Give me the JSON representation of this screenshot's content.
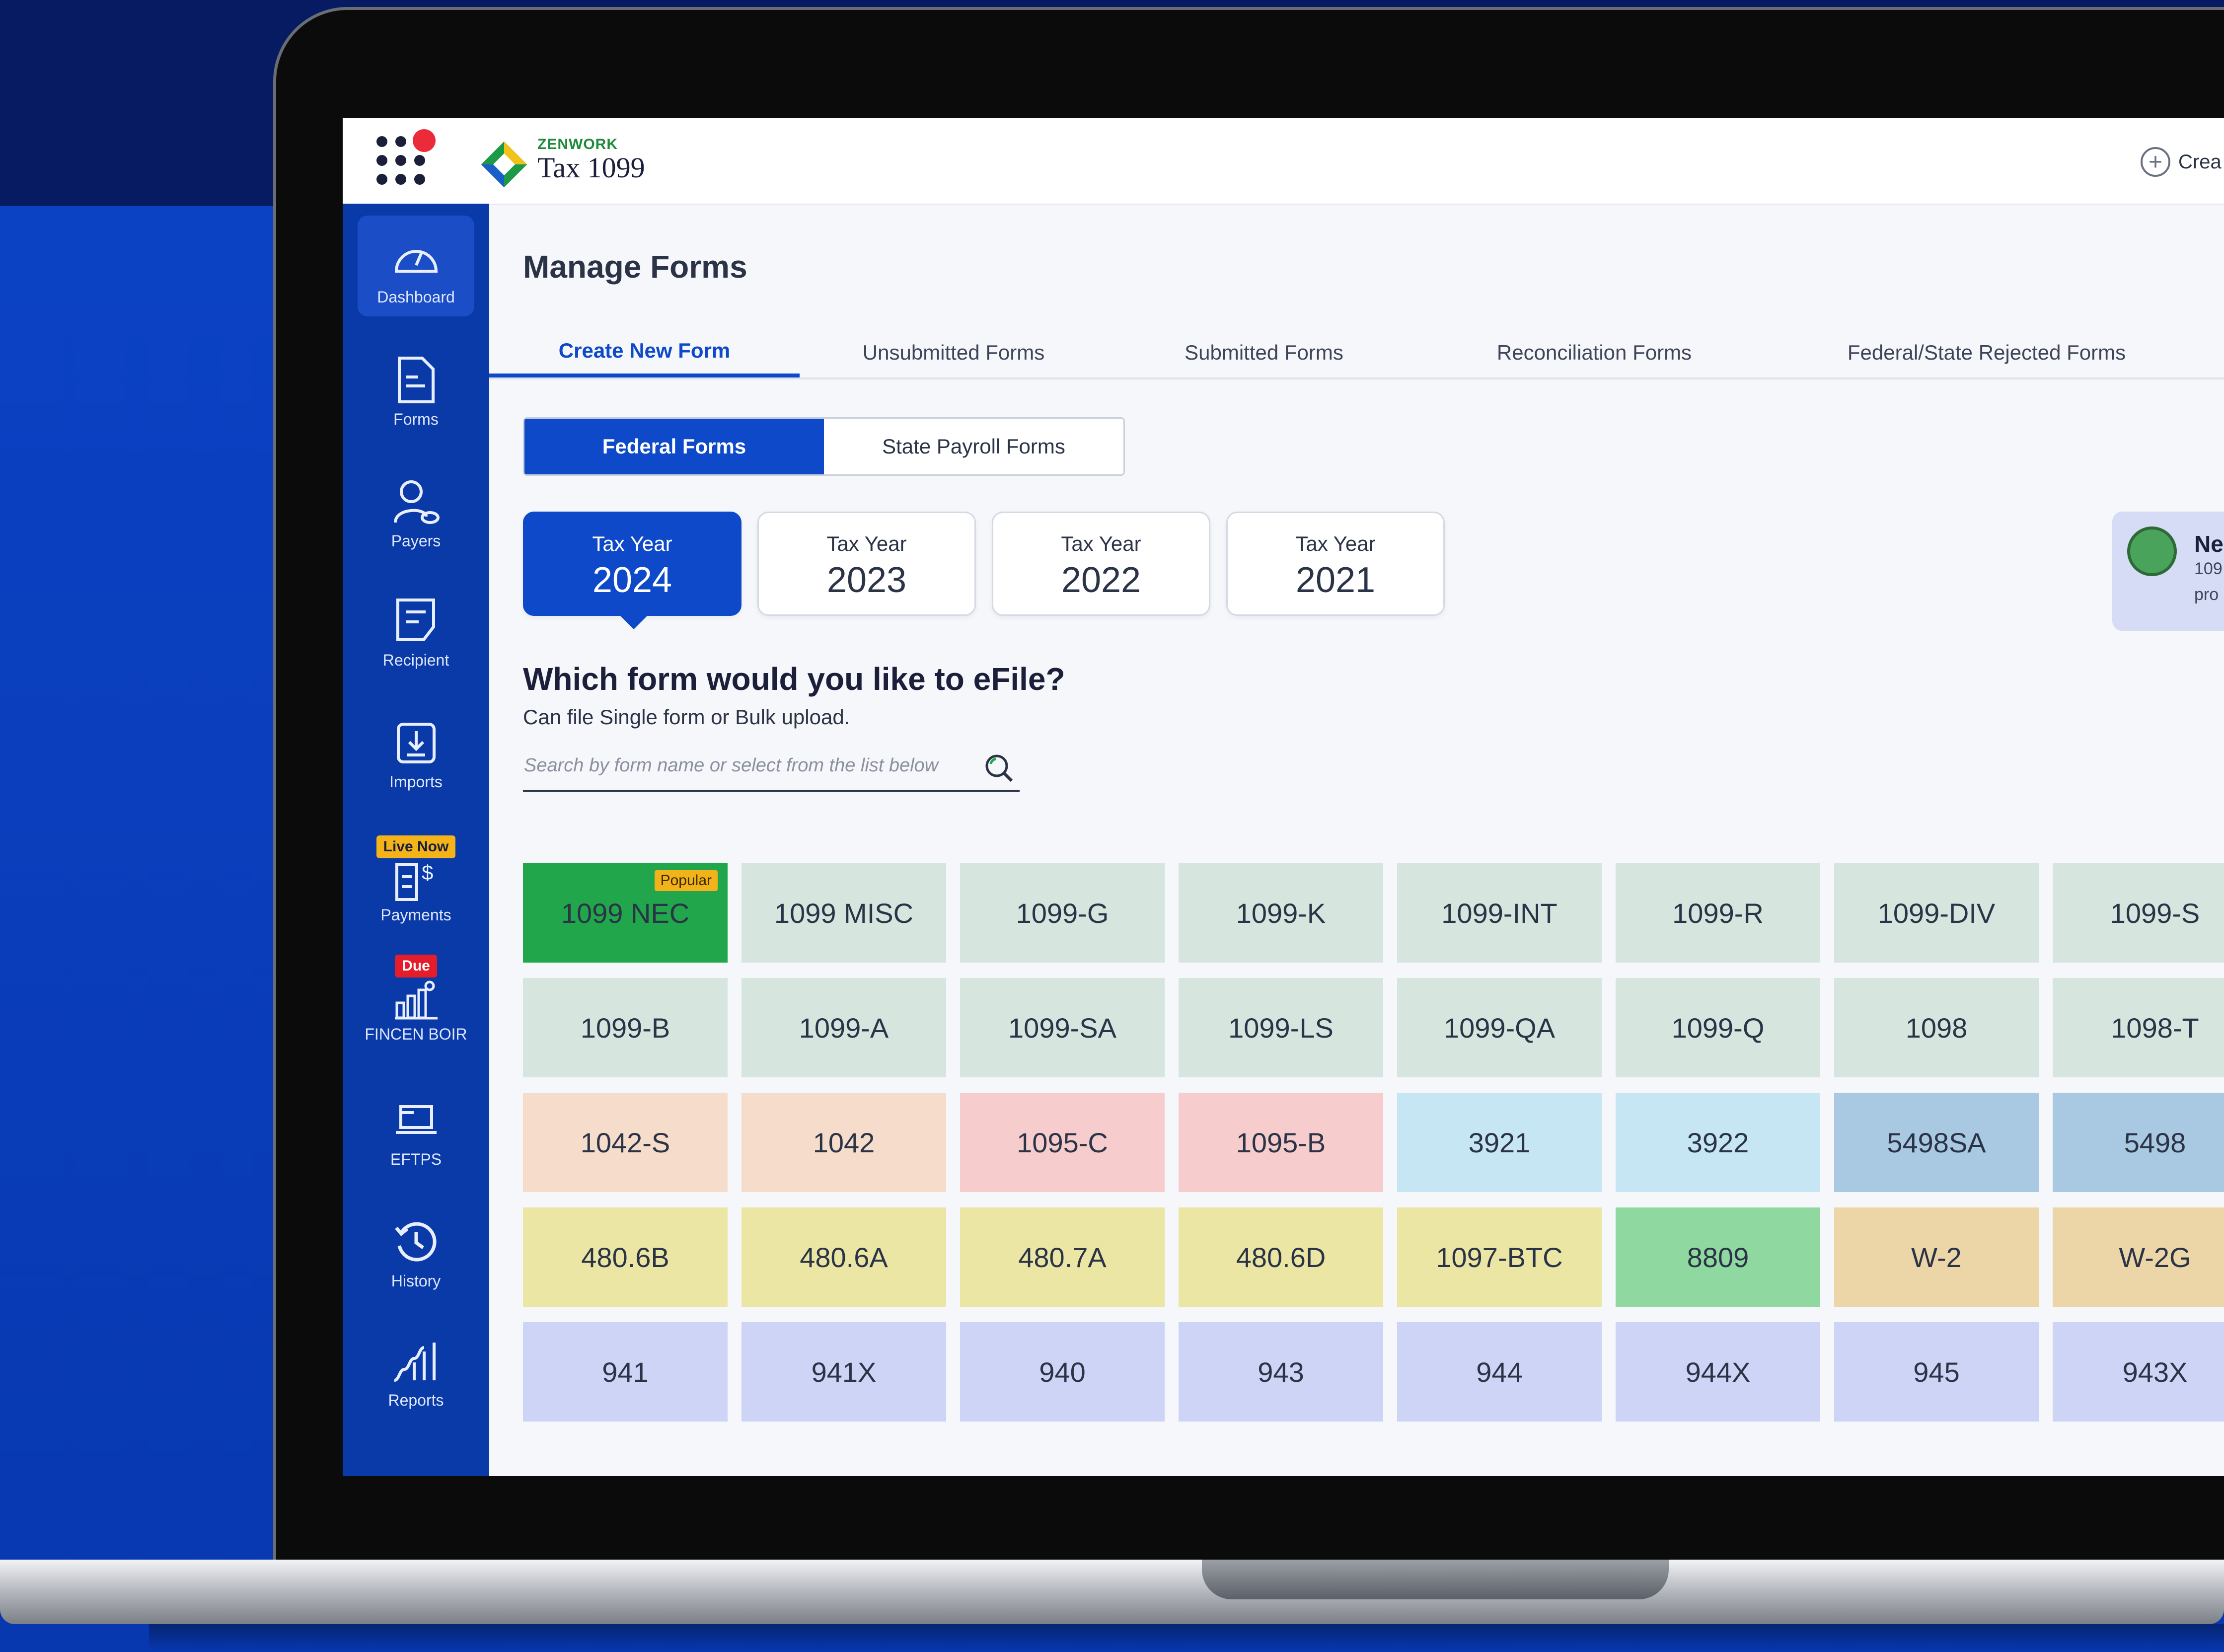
{
  "header": {
    "brand_small": "ZENWORK",
    "brand_name": "Tax 1099",
    "create_label": "Crea"
  },
  "sidebar": {
    "items": [
      {
        "label": "Dashboard",
        "icon": "gauge-icon"
      },
      {
        "label": "Forms",
        "icon": "document-icon"
      },
      {
        "label": "Payers",
        "icon": "payer-icon"
      },
      {
        "label": "Recipient",
        "icon": "recipient-icon"
      },
      {
        "label": "Imports",
        "icon": "import-icon"
      },
      {
        "label": "Payments",
        "icon": "payments-icon",
        "badge": "Live Now"
      },
      {
        "label": "FINCEN BOIR",
        "icon": "building-chart-icon",
        "badge": "Due"
      },
      {
        "label": "EFTPS",
        "icon": "eftps-icon"
      },
      {
        "label": "History",
        "icon": "history-icon"
      },
      {
        "label": "Reports",
        "icon": "reports-icon"
      }
    ]
  },
  "main": {
    "title": "Manage Forms",
    "tabs": [
      {
        "label": "Create New Form",
        "active": true
      },
      {
        "label": "Unsubmitted Forms"
      },
      {
        "label": "Submitted Forms"
      },
      {
        "label": "Reconciliation Forms"
      },
      {
        "label": "Federal/State Rejected Forms"
      }
    ],
    "segments": [
      {
        "label": "Federal Forms",
        "active": true
      },
      {
        "label": "State Payroll Forms"
      }
    ],
    "year_label": "Tax Year",
    "years": [
      "2024",
      "2023",
      "2022",
      "2021"
    ],
    "news": {
      "title": "Ne",
      "line1": "109",
      "line2": "pro"
    },
    "question": "Which form would you like to eFile?",
    "subtext": "Can file Single form or Bulk upload.",
    "search_placeholder": "Search by form name or select from the list below",
    "popular_badge": "Popular",
    "forms": [
      [
        "1099 NEC",
        "1099 MISC",
        "1099-G",
        "1099-K",
        "1099-INT",
        "1099-R",
        "1099-DIV",
        "1099-S"
      ],
      [
        "1099-B",
        "1099-A",
        "1099-SA",
        "1099-LS",
        "1099-QA",
        "1099-Q",
        "1098",
        "1098-T"
      ],
      [
        "1042-S",
        "1042",
        "1095-C",
        "1095-B",
        "3921",
        "3922",
        "5498SA",
        "5498"
      ],
      [
        "480.6B",
        "480.6A",
        "480.7A",
        "480.6D",
        "1097-BTC",
        "8809",
        "W-2",
        "W-2G"
      ],
      [
        "941",
        "941X",
        "940",
        "943",
        "944",
        "944X",
        "945",
        "943X"
      ]
    ],
    "form_colors": [
      [
        "#22a64b",
        "#d6e6df",
        "#d6e6df",
        "#d6e6df",
        "#d6e6df",
        "#d6e6df",
        "#d6e6df",
        "#d6e6df"
      ],
      [
        "#d6e6df",
        "#d6e6df",
        "#d6e6df",
        "#d6e6df",
        "#d6e6df",
        "#d6e6df",
        "#d6e6df",
        "#d6e6df"
      ],
      [
        "#f5dccb",
        "#f5dccb",
        "#f6cccd",
        "#f6cccd",
        "#c6e6f3",
        "#c6e6f3",
        "#a9c8e2",
        "#a9c8e2"
      ],
      [
        "#ece6a5",
        "#ece6a5",
        "#ece6a5",
        "#ece6a5",
        "#ece6a5",
        "#8fd9a1",
        "#ecd6a8",
        "#ecd6a8"
      ],
      [
        "#cdd4f6",
        "#cdd4f6",
        "#cdd4f6",
        "#cdd4f6",
        "#cdd4f6",
        "#cdd4f6",
        "#cdd4f6",
        "#cdd4f6"
      ]
    ]
  }
}
